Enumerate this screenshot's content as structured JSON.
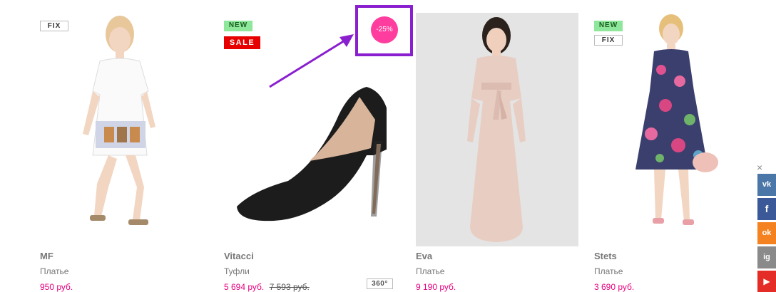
{
  "products": [
    {
      "brand": "MF",
      "category": "Платье",
      "price": "950 руб.",
      "old_price": "",
      "badges": [
        "FIX"
      ]
    },
    {
      "brand": "Vitacci",
      "category": "Туфли",
      "price": "5 694 руб.",
      "old_price": "7 593 руб.",
      "badges": [
        "NEW",
        "SALE"
      ],
      "view_360_label": "360°"
    },
    {
      "brand": "Eva",
      "category": "Платье",
      "price": "9 190 руб.",
      "old_price": "",
      "badges": []
    },
    {
      "brand": "Stets",
      "category": "Платье",
      "price": "3 690 руб.",
      "old_price": "",
      "badges": [
        "NEW",
        "FIX"
      ]
    }
  ],
  "discount": {
    "label": "-25%"
  },
  "colors": {
    "accent": "#e6007e",
    "discount_badge": "#ff3d9e",
    "highlight_frame": "#8a1fcf",
    "new_badge": "#8fe79b",
    "sale_badge": "#e60000"
  },
  "social": {
    "close_label": "×",
    "items": [
      {
        "name": "vk",
        "label": "vk",
        "color": "#4a76a8"
      },
      {
        "name": "facebook",
        "label": "f",
        "color": "#3b5998"
      },
      {
        "name": "odnoklassniki",
        "label": "ok",
        "color": "#f58220"
      },
      {
        "name": "instagram",
        "label": "ig",
        "color": "#8a8a8a"
      },
      {
        "name": "youtube",
        "label": "▶",
        "color": "#e52d27"
      }
    ]
  }
}
